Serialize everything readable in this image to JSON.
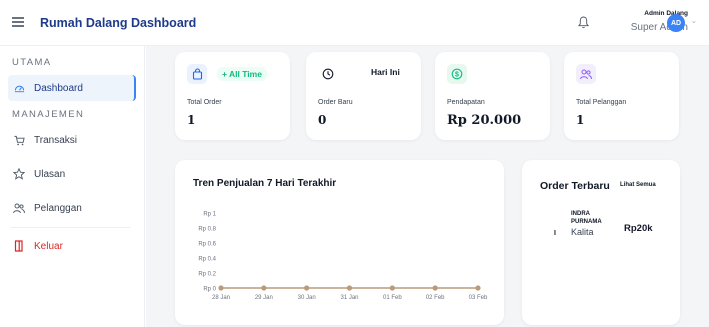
{
  "header": {
    "title": "Rumah Dalang Dashboard",
    "user_name": "Admin Dalang",
    "user_role": "Super Admin",
    "avatar_initials": "AD"
  },
  "sidebar": {
    "section_main": "UTAMA",
    "section_manage": "MANAJEMEN",
    "items": [
      {
        "label": "Dashboard",
        "icon": "dashboard-icon",
        "active": true
      },
      {
        "label": "Transaksi",
        "icon": "cart-icon"
      },
      {
        "label": "Ulasan",
        "icon": "star-icon"
      },
      {
        "label": "Pelanggan",
        "icon": "users-icon"
      },
      {
        "label": "Keluar",
        "icon": "logout-icon",
        "color": "#dc2626"
      }
    ]
  },
  "stats": [
    {
      "label": "Total Order",
      "value": "1",
      "badge": "+ All Time",
      "icon": "bag-icon",
      "icon_bg": "#eaf2fd",
      "icon_color": "#2563eb"
    },
    {
      "label": "Order Baru",
      "value": "0",
      "badge": "Hari Ini",
      "icon": "clock-icon"
    },
    {
      "label": "Pendapatan",
      "value": "Rp 20.000",
      "icon": "dollar-icon",
      "icon_bg": "#e7f8ef",
      "icon_color": "#10b981"
    },
    {
      "label": "Total Pelanggan",
      "value": "1",
      "icon": "users-icon",
      "icon_bg": "#f3eefc",
      "icon_color": "#8b5cf6"
    }
  ],
  "chart": {
    "title": "Tren Penjualan 7 Hari Terakhir"
  },
  "chart_data": {
    "type": "line",
    "categories": [
      "28 Jan",
      "29 Jan",
      "30 Jan",
      "31 Jan",
      "01 Feb",
      "02 Feb",
      "03 Feb"
    ],
    "values": [
      0,
      0,
      0,
      0,
      0,
      0,
      0
    ],
    "y_ticks": [
      "Rp 1",
      "Rp 0.8",
      "Rp 0.6",
      "Rp 0.4",
      "Rp 0.2",
      "Rp 0"
    ],
    "ylim": [
      0,
      1
    ],
    "color": "#b99b7a",
    "legend": "none"
  },
  "recent": {
    "title": "Order Terbaru",
    "see_all": "Lihat Semua",
    "orders": [
      {
        "rank": "I",
        "name": "INDRA PURNAMA",
        "detail": "Kalita",
        "amount": "Rp20k"
      }
    ]
  }
}
